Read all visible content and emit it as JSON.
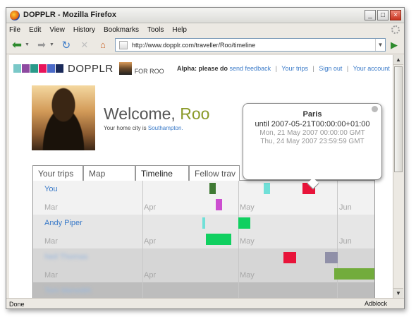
{
  "window": {
    "title": "DOPPLR - Mozilla Firefox"
  },
  "menu": [
    "File",
    "Edit",
    "View",
    "History",
    "Bookmarks",
    "Tools",
    "Help"
  ],
  "address": {
    "url": "http://www.dopplr.com/traveller/Roo/timeline"
  },
  "status": {
    "left": "Done",
    "right": "Adblock"
  },
  "page": {
    "brand": "DOPPLR",
    "for_label": "FOR ROO",
    "logo_colors": [
      "#7ac8c8",
      "#8e4aa0",
      "#2a9a8a",
      "#e8145a",
      "#4a6ac8",
      "#1a2a5a"
    ],
    "alpha_label": "Alpha: please do",
    "links": [
      "send feedback",
      "Your trips",
      "Sign out",
      "Your account"
    ],
    "welcome_prefix": "Welcome,",
    "welcome_name": "Roo",
    "home_city_prefix": "Your home city is",
    "home_city": "Southampton.",
    "tabs": [
      "Your trips",
      "Map",
      "Timeline",
      "Fellow trav"
    ],
    "months": [
      "Mar",
      "Apr",
      "May",
      "Jun"
    ],
    "rows": [
      {
        "name": "You"
      },
      {
        "name": "Andy Piper"
      },
      {
        "name": "Neil Thomas"
      },
      {
        "name": "Tom Meredith"
      }
    ],
    "popup": {
      "title": "Paris",
      "line1": "until 2007-05-21T00:00:00+01:00",
      "line2": "Mon, 21 May 2007 00:00:00 GMT",
      "line3": "Thu, 24 May 2007 23:59:59 GMT"
    },
    "trip_colors": {
      "dark_green": "#3f7a34",
      "aqua": "#70e0d8",
      "red": "#e8143a",
      "magenta": "#cc4ed0",
      "green": "#10d060",
      "grey_purple": "#9090a8",
      "olive": "#72ac3c"
    }
  }
}
